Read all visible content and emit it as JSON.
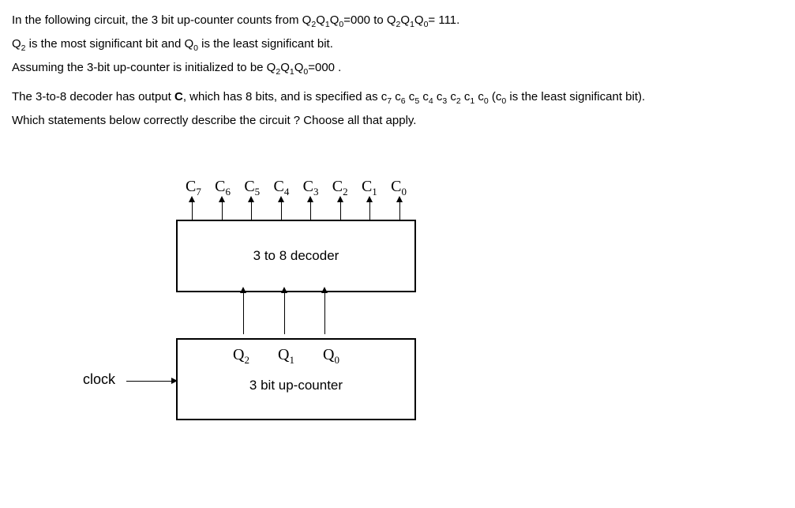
{
  "question": {
    "line1_pre": "In the following circuit, the 3 bit up-counter counts from Q",
    "line1_mid1": "Q",
    "line1_mid2": "Q",
    "line1_mid3": "=000 to  Q",
    "line1_mid4": "Q",
    "line1_mid5": "Q",
    "line1_end": "= 111.",
    "line2_pre": "Q",
    "line2_mid": " is the most significant bit and Q",
    "line2_end": " is the least significant bit.",
    "line3_pre": "Assuming the 3-bit up-counter is initialized to be Q",
    "line3_mid1": "Q",
    "line3_mid2": "Q",
    "line3_end": "=000 .",
    "line4_pre": "The 3-to-8 decoder has output ",
    "line4_bold": "C",
    "line4_mid": ", which has 8 bits, and is specified as c",
    "line4_c": " c",
    "line4_paren_pre": " (c",
    "line4_paren_end": " is the least significant bit).",
    "line5": "Which statements below correctly describe the circuit ? Choose all that apply."
  },
  "diagram": {
    "outputs_prefix": "C",
    "outputs": [
      "7",
      "6",
      "5",
      "4",
      "3",
      "2",
      "1",
      "0"
    ],
    "decoder_label": "3 to 8 decoder",
    "inputs_prefix": "Q",
    "inputs": [
      "2",
      "1",
      "0"
    ],
    "counter_label": "3 bit up-counter",
    "clock_label": "clock"
  }
}
